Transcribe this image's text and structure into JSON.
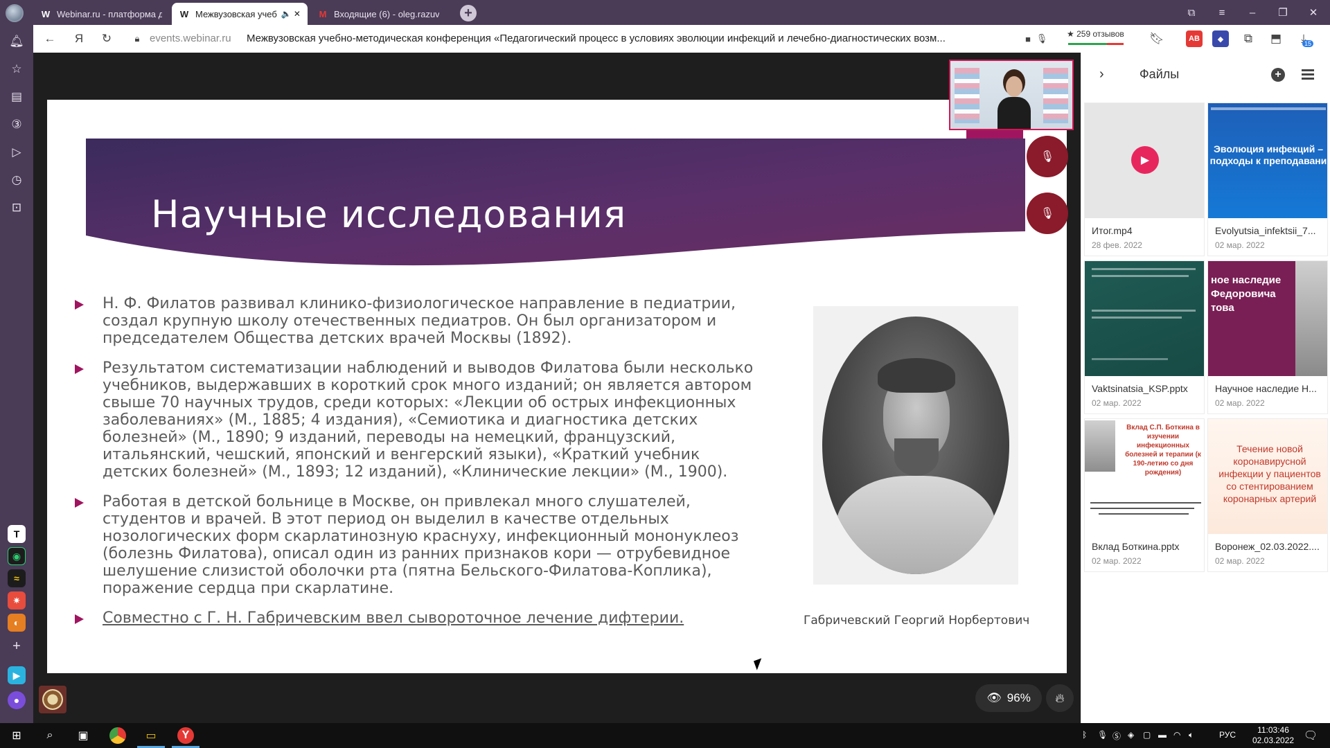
{
  "browser": {
    "tabs": [
      {
        "favicon": "W",
        "label": "Webinar.ru - платформа д"
      },
      {
        "favicon": "W",
        "label": "Межвузовская учеб",
        "extra": "🔈 ✕"
      },
      {
        "favicon": "M",
        "label": "Входящие (6) - oleg.razuva"
      }
    ],
    "newtab_label": "+",
    "url_host": "events.webinar.ru",
    "page_title": "Межвузовская учебно-методическая конференция «Педагогический процесс в условиях эволюции инфекций и лечебно-диагностических возм...",
    "reviews": "★ 259 отзывов",
    "ext_badge": "15",
    "ext_ru_badge": "AB"
  },
  "slide": {
    "title": "Научные исследования",
    "bullets": [
      "Н. Ф. Филатов развивал клинико-физиологическое направление в педиатрии, создал крупную школу отечественных педиатров. Он был организатором и председателем Общества детских врачей Москвы (1892).",
      "Результатом систематизации наблюдений и выводов Филатова были несколько учебников, выдержавших в короткий срок много изданий; он является автором свыше 70 научных трудов, среди которых: «Лекции об острых инфекционных заболеваниях» (М., 1885; 4 издания), «Семиотика и диагностика детских болезней» (М., 1890; 9 изданий, переводы на немецкий, французский, итальянский, чешский, японский и венгерский языки), «Краткий учебник детских болезней» (М., 1893; 12 изданий), «Клинические лекции» (М., 1900).",
      "Работая в детской больнице в Москве, он привлекал много слушателей, студентов и врачей. В этот период он выделил в качестве отдельных нозологических форм скарлатинозную краснуху, инфекционный мононуклеоз (болезнь Филатова), описал один из ранних признаков кори — отрубевидное шелушение слизистой оболочки рта (пятна Бельского-Филатова-Коплика), поражение сердца при скарлатине.",
      "Совместно с Г. Н. Габричевским ввел сывороточное лечение дифтерии."
    ],
    "caption": "Габричевский Георгий Норбертович"
  },
  "stage": {
    "viewers_percent": "96%"
  },
  "files": {
    "title": "Файлы",
    "items": [
      {
        "name": "Итог.mp4",
        "date": "28 фев. 2022"
      },
      {
        "name": "Evolyutsia_infektsii_7...",
        "date": "02 мар. 2022",
        "thumb_title": "Эволюция инфекций – подходы к преподавани"
      },
      {
        "name": "Vaktsinatsia_KSP.pptx",
        "date": "02 мар. 2022"
      },
      {
        "name": "Научное наследие Н...",
        "date": "02 мар. 2022",
        "thumb_title": "ное наследие Федоровича това"
      },
      {
        "name": "Вклад Боткина.pptx",
        "date": "02 мар. 2022",
        "thumb_title": "Вклад С.П. Боткина в изучении инфекционных болезней и терапии (к 190-летию со дня рождения)"
      },
      {
        "name": "Воронеж_02.03.2022....",
        "date": "02 мар. 2022",
        "thumb_title": "Течение новой коронавирусной инфекции у пациентов со стентированием коронарных артерий"
      }
    ]
  },
  "taskbar": {
    "lang": "РУС",
    "time": "11:03:46",
    "date": "02.03.2022"
  },
  "colors": {
    "browser_chrome": "#4a3b57",
    "accent_magenta": "#a0155f",
    "mic_red": "#8b1a2a",
    "play_pink": "#e8265e"
  }
}
